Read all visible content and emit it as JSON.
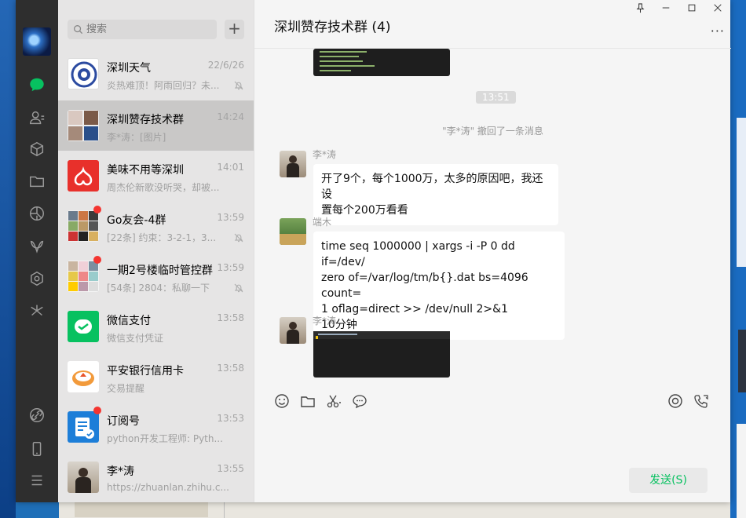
{
  "search": {
    "placeholder": "搜索"
  },
  "chat_list": [
    {
      "name": "深圳天气",
      "time": "22/6/26",
      "preview": "炎热难顶！阿雨回归？未...",
      "muted": true
    },
    {
      "name": "深圳赞存技术群",
      "time": "14:24",
      "preview": "李*涛：[图片]",
      "active": true
    },
    {
      "name": "美味不用等深圳",
      "time": "14:01",
      "preview": "周杰伦新歌没听哭，却被..."
    },
    {
      "name": "Go友会-4群",
      "time": "13:59",
      "preview": "[22条] 约束：3-2-1，3...",
      "muted": true,
      "unread": true
    },
    {
      "name": "一期2号楼临时管控群",
      "time": "13:59",
      "preview": "[54条] 2804：私聊一下",
      "muted": true,
      "unread": true
    },
    {
      "name": "微信支付",
      "time": "13:58",
      "preview": "微信支付凭证"
    },
    {
      "name": "平安银行信用卡",
      "time": "13:58",
      "preview": "交易提醒"
    },
    {
      "name": "订阅号",
      "time": "13:53",
      "preview": "python开发工程师: Pyth...",
      "unread": true
    },
    {
      "name": "李*涛",
      "time": "13:55",
      "preview": "https://zhuanlan.zhihu.c..."
    }
  ],
  "chat": {
    "title": "深圳赞存技术群 (4)",
    "time_chip": "13:51",
    "system_msg": "\"李*涛\" 撤回了一条消息",
    "messages": [
      {
        "sender": "李*涛",
        "text": "开了9个，每个1000万，太多的原因吧，我还设\n置每个200万看看"
      },
      {
        "sender": "端木",
        "text": "time seq 1000000 | xargs -i -P 0 dd if=/dev/\nzero of=/var/log/tm/b{}.dat bs=4096 count=\n1 oflag=direct >> /dev/null 2>&1\n10分钟"
      },
      {
        "sender": "李*涛",
        "text": ""
      }
    ],
    "send_label": "发送(S)"
  },
  "colors": {
    "accent": "#07c160",
    "unread": "#f43530",
    "nav_bg": "#2e2e2e"
  }
}
